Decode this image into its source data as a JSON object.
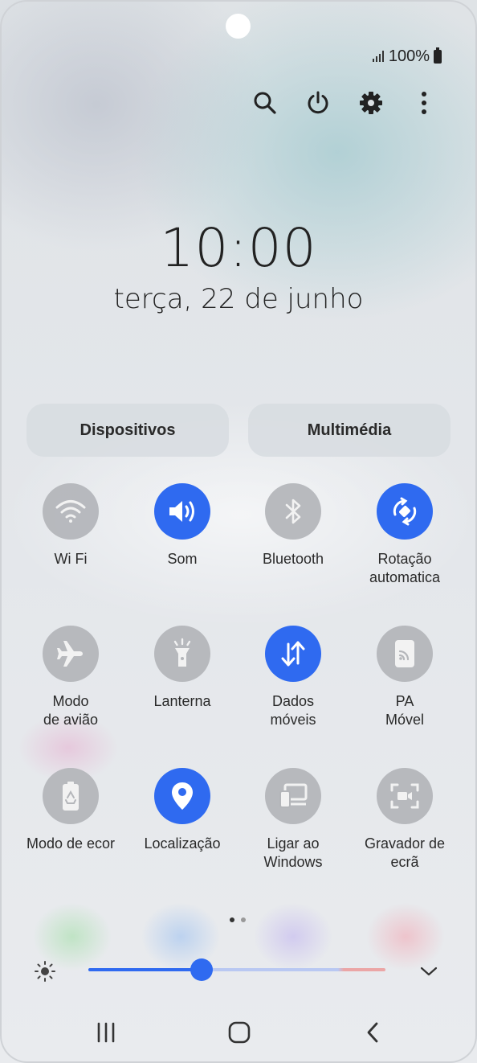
{
  "status_bar": {
    "battery_text": "100%",
    "signal_icon": "signal-icon",
    "battery_icon": "battery-icon"
  },
  "header_actions": [
    {
      "name": "search-icon"
    },
    {
      "name": "power-icon"
    },
    {
      "name": "gear-icon"
    },
    {
      "name": "more-options-icon"
    }
  ],
  "clock": {
    "time": "10:00",
    "date": "terça, 22 de junho"
  },
  "buttons": {
    "devices": "Dispositivos",
    "media": "Multimédia"
  },
  "accent_color": "#2f6af0",
  "quick_settings": [
    {
      "label": "Wi Fi",
      "active": false,
      "icon": "wifi-icon"
    },
    {
      "label": "Som",
      "active": true,
      "icon": "volume-icon"
    },
    {
      "label": "Bluetooth",
      "active": false,
      "icon": "bluetooth-icon"
    },
    {
      "label": "Rotação\nautomatica",
      "active": true,
      "icon": "auto-rotate-icon"
    },
    {
      "label": "Modo\nde avião",
      "active": false,
      "icon": "airplane-icon"
    },
    {
      "label": "Lanterna",
      "active": false,
      "icon": "flashlight-icon"
    },
    {
      "label": "Dados\nmóveis",
      "active": true,
      "icon": "mobile-data-icon"
    },
    {
      "label": "PA\nMóvel",
      "active": false,
      "icon": "mobile-hotspot-icon"
    },
    {
      "label": "Modo de ecor",
      "active": false,
      "icon": "power-saving-icon"
    },
    {
      "label": "Localização",
      "active": true,
      "icon": "location-icon"
    },
    {
      "label": "Ligar ao\nWindows",
      "active": false,
      "icon": "link-to-windows-icon"
    },
    {
      "label": "Gravador de\necrã",
      "active": false,
      "icon": "screen-recorder-icon"
    }
  ],
  "pagination": {
    "pages": 2,
    "current": 1
  },
  "brightness": {
    "level": 0.38,
    "icon": "brightness-icon",
    "expand_icon": "chevron-down-icon"
  },
  "nav_bar": [
    {
      "name": "recent-apps-icon"
    },
    {
      "name": "home-icon"
    },
    {
      "name": "back-icon"
    }
  ]
}
